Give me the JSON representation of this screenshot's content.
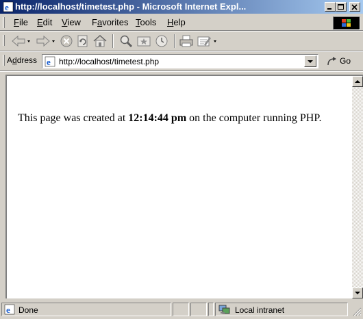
{
  "window": {
    "title": "http://localhost/timetest.php - Microsoft Internet Expl..."
  },
  "menu": {
    "items": [
      {
        "accel": "F",
        "rest": "ile"
      },
      {
        "accel": "E",
        "rest": "dit"
      },
      {
        "accel": "V",
        "rest": "iew"
      },
      {
        "pre": "F",
        "accel": "a",
        "rest": "vorites"
      },
      {
        "accel": "T",
        "rest": "ools"
      },
      {
        "accel": "H",
        "rest": "elp"
      }
    ]
  },
  "toolbar": {
    "icons": [
      "back-icon",
      "forward-icon",
      "stop-icon",
      "refresh-icon",
      "home-icon",
      "search-icon",
      "favorites-icon",
      "history-icon",
      "print-icon",
      "edit-icon"
    ]
  },
  "address": {
    "label_accel": "d",
    "label_pre": "A",
    "label_rest": "dress",
    "url": "http://localhost/timetest.php",
    "go_label": "Go"
  },
  "content": {
    "text_before": "This page was created at ",
    "time": "12:14:44 pm",
    "text_after": " on the computer running PHP."
  },
  "status": {
    "left_text": "Done",
    "zone_text": "Local intranet"
  },
  "colors": {
    "title_start": "#0a246a",
    "title_end": "#a6caf0",
    "chrome": "#d4d0c8"
  }
}
